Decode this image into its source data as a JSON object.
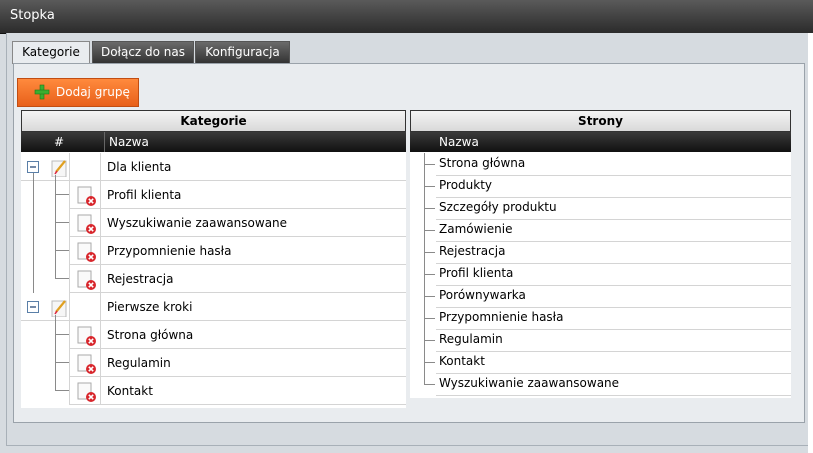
{
  "window": {
    "title": "Stopka"
  },
  "tabs": [
    {
      "label": "Kategorie",
      "active": true
    },
    {
      "label": "Dołącz do nas",
      "active": false
    },
    {
      "label": "Konfiguracja",
      "active": false
    }
  ],
  "toolbar": {
    "add_group_label": "Dodaj grupę"
  },
  "categories_panel": {
    "title": "Kategorie",
    "columns": {
      "hash": "#",
      "name": "Nazwa"
    },
    "groups": [
      {
        "name": "Dla klienta",
        "items": [
          "Profil klienta",
          "Wyszukiwanie zaawansowane",
          "Przypomnienie hasła",
          "Rejestracja"
        ]
      },
      {
        "name": "Pierwsze kroki",
        "items": [
          "Strona główna",
          "Regulamin",
          "Kontakt"
        ]
      }
    ]
  },
  "pages_panel": {
    "title": "Strony",
    "column_name": "Nazwa",
    "items": [
      "Strona główna",
      "Produkty",
      "Szczegóły produktu",
      "Zamówienie",
      "Rejestracja",
      "Profil klienta",
      "Porównywarka",
      "Przypomnienie hasła",
      "Regulamin",
      "Kontakt",
      "Wyszukiwanie zaawansowane"
    ]
  },
  "colors": {
    "accent": "#f07028",
    "header_dark": "#1a1a1a",
    "panel_bg": "#e9ecef"
  }
}
